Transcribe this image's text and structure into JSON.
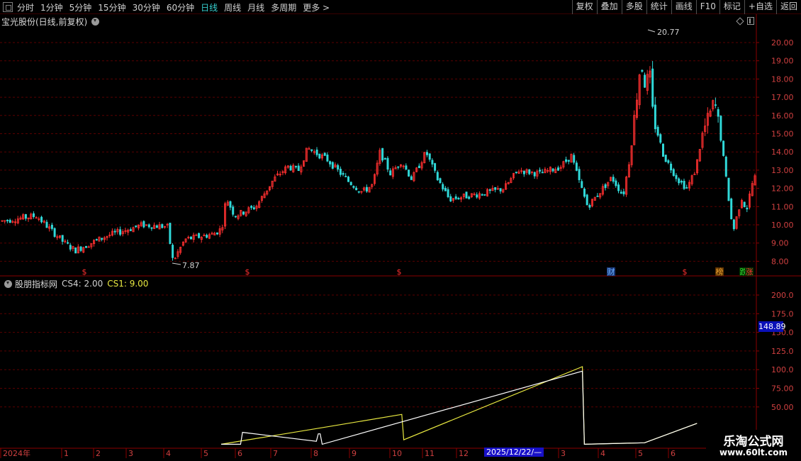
{
  "toolbar": {
    "periods": [
      "分时",
      "1分钟",
      "5分钟",
      "15分钟",
      "30分钟",
      "60分钟",
      "日线",
      "周线",
      "月线",
      "多周期",
      "更多"
    ],
    "active_index": 6,
    "more_arrow": ">",
    "buttons": [
      "复权",
      "叠加",
      "多股",
      "统计",
      "画线",
      "F10",
      "标记",
      "+自选",
      "返回"
    ]
  },
  "main_chart": {
    "title": "宝光股份(日线,前复权)",
    "y_ticks": [
      "20.00",
      "19.00",
      "18.00",
      "17.00",
      "16.00",
      "15.00",
      "14.00",
      "13.00",
      "12.00",
      "11.00",
      "10.00",
      "9.00",
      "8.00"
    ],
    "high_label": "20.77",
    "low_label": "7.87",
    "markers": [
      {
        "text": "$",
        "type": "dividend"
      },
      {
        "text": "$",
        "type": "dividend"
      },
      {
        "text": "$",
        "type": "dividend"
      },
      {
        "text": "财",
        "type": "finance"
      },
      {
        "text": "$",
        "type": "dividend"
      },
      {
        "text": "榜",
        "type": "rank"
      },
      {
        "text": "跌",
        "type": "down"
      },
      {
        "text": "涨",
        "type": "up"
      }
    ],
    "colors": {
      "up": "#ff3030",
      "down": "#30d8d8",
      "grid": "#5a0000"
    }
  },
  "indicator": {
    "name": "股朋指标网",
    "labels": [
      {
        "text": "CS4: 2.00",
        "color": "white"
      },
      {
        "text": "CS1: 9.00",
        "color": "yellow"
      }
    ],
    "y_ticks": [
      "200.0",
      "175.0",
      "150.0",
      "125.0",
      "100.0",
      "75.00",
      "50.00"
    ],
    "current_value": "148.89"
  },
  "x_axis": {
    "labels": [
      "2024年",
      "1",
      "2",
      "3",
      "4",
      "5",
      "6",
      "7",
      "8",
      "9",
      "10",
      "11",
      "12",
      "3",
      "4",
      "5",
      "6"
    ],
    "selected_date": "2025/12/22/—"
  },
  "watermark": {
    "title": "乐淘公式网",
    "url": "www.60lt.com"
  },
  "chart_data": {
    "type": "line",
    "title": "",
    "series": [
      {
        "name": "CS1",
        "color": "#e8e840",
        "points": [
          [
            0,
            0
          ],
          [
            56,
            24
          ],
          [
            93,
            40
          ],
          [
            94,
            6
          ],
          [
            186,
            104
          ],
          [
            187,
            0
          ],
          [
            218,
            2
          ],
          [
            245,
            28
          ]
        ]
      },
      {
        "name": "CS4",
        "color": "#ffffff",
        "points": [
          [
            0,
            0
          ],
          [
            10,
            0
          ],
          [
            11,
            16
          ],
          [
            49,
            4
          ],
          [
            50,
            14
          ],
          [
            51,
            14
          ],
          [
            52,
            0
          ],
          [
            186,
            98
          ],
          [
            187,
            0
          ],
          [
            218,
            2
          ],
          [
            245,
            28
          ]
        ]
      }
    ],
    "ylim": [
      0,
      210
    ]
  }
}
